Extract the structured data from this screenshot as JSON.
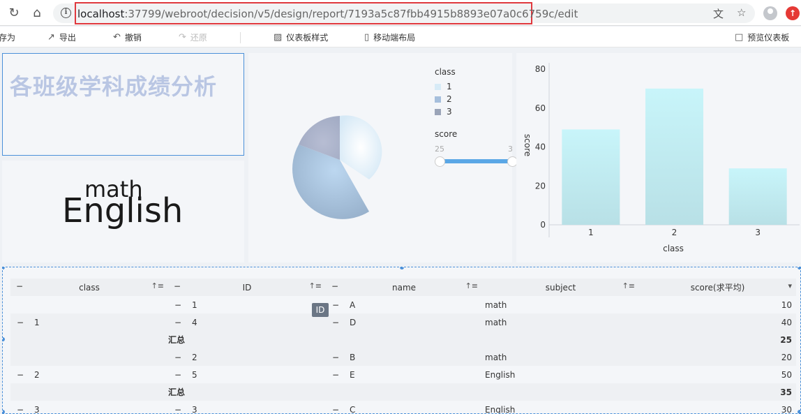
{
  "browser": {
    "url_host": "localhost",
    "url_rest": ":37799/webroot/decision/v5/design/report/7193a5c87fbb4915b8893e07a0c6759c/edit"
  },
  "toolbar": {
    "save_as_label": "存为",
    "export_label": "导出",
    "undo_label": "撤销",
    "redo_label": "还原",
    "dashboard_style_label": "仪表板样式",
    "mobile_layout_label": "移动端布局",
    "preview_label": "预览仪表板"
  },
  "title_widget": {
    "text": "各班级学科成绩分析"
  },
  "word_cloud": {
    "words": [
      "math",
      "English"
    ]
  },
  "pie_widget": {
    "legend_title": "class",
    "legend_items": [
      "1",
      "2",
      "3"
    ],
    "slider_title": "score",
    "slider_min_label": "25",
    "slider_max_label": "3"
  },
  "chart_data": {
    "type": "bar",
    "categories": [
      "1",
      "2",
      "3"
    ],
    "values": [
      49,
      70,
      29
    ],
    "xlabel": "class",
    "ylabel": "score",
    "ylim": [
      0,
      80
    ],
    "yticks": [
      "0",
      "20",
      "40",
      "60",
      "80"
    ],
    "colors": {
      "bar_top": "#c8f5fa",
      "bar_bottom": "#b8e0e6"
    }
  },
  "table": {
    "headers": [
      "class",
      "ID",
      "name",
      "subject",
      "score(求平均)"
    ],
    "tooltip": "ID",
    "rows": [
      {
        "class": "",
        "id": "1",
        "name": "A",
        "subject": "math",
        "score": "10",
        "style": "plain"
      },
      {
        "class": "1",
        "id": "4",
        "name": "D",
        "subject": "math",
        "score": "40",
        "style": "plain"
      },
      {
        "class": "",
        "id": "汇总",
        "name": "",
        "subject": "",
        "score": "25",
        "style": "total"
      },
      {
        "class": "",
        "id": "2",
        "name": "B",
        "subject": "math",
        "score": "20",
        "style": "plain"
      },
      {
        "class": "2",
        "id": "5",
        "name": "E",
        "subject": "English",
        "score": "50",
        "style": "plain"
      },
      {
        "class": "",
        "id": "汇总",
        "name": "",
        "subject": "",
        "score": "35",
        "style": "total"
      },
      {
        "class": "3",
        "id": "3",
        "name": "C",
        "subject": "English",
        "score": "30",
        "style": "plain"
      }
    ]
  },
  "colors": {
    "pie_slices": [
      "#e6f2fa",
      "#a9c4e2",
      "#a8b2c9"
    ],
    "accent": "#4a90d9",
    "title_text": "#b9c6e3"
  }
}
